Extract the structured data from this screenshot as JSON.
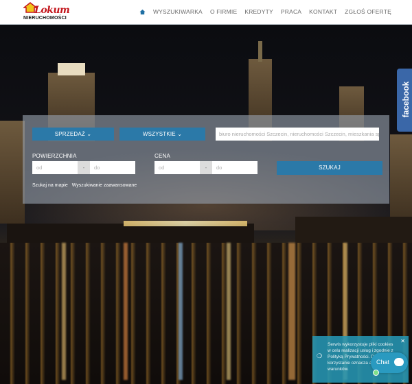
{
  "header": {
    "logo_word": "Lokum",
    "logo_sub": "NIERUCHOMOŚCI",
    "nav": [
      "WYSZUKIWARKA",
      "O FIRMIE",
      "KREDYTY",
      "PRACA",
      "KONTAKT",
      "ZGŁOŚ OFERTĘ"
    ]
  },
  "search": {
    "type_select": "SPRZEDAŻ",
    "category_select": "WSZYSTKIE",
    "keyword_placeholder": "biuro nieruchomości Szczecin, nieruchomości Szczecin, mieszkania sprz",
    "area_label": "POWIERZCHNIA",
    "price_label": "CENA",
    "from_placeholder": "od",
    "to_placeholder": "do",
    "price_to_placeholder": "do",
    "dash": "-",
    "search_button": "SZUKAJ",
    "link_map": "Szukaj na mapie",
    "link_advanced": "Wyszukiwanie zaawansowane"
  },
  "facebook_label": "facebook",
  "cookie": {
    "text": "Serwis wykorzystuje pliki cookies w celu realizacji usług i zgodnie z Polityką Prywatności. Dalsze korzystanie oznacza akceptację warunków."
  },
  "chat": {
    "label": "Chat"
  }
}
